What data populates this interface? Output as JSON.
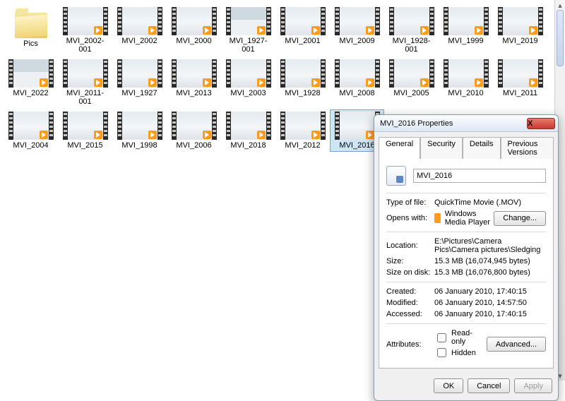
{
  "explorer": {
    "folder_label": "Pics",
    "items": [
      {
        "label": "MVI_2002-001",
        "scene": "snow"
      },
      {
        "label": "MVI_2002",
        "scene": "snow"
      },
      {
        "label": "MVI_2000",
        "scene": "snow"
      },
      {
        "label": "MVI_1927-001",
        "scene": "sky"
      },
      {
        "label": "MVI_2001",
        "scene": "snow"
      },
      {
        "label": "MVI_2009",
        "scene": "snow"
      },
      {
        "label": "MVI_1928-001",
        "scene": "snow"
      },
      {
        "label": "MVI_1999",
        "scene": "snow"
      },
      {
        "label": "MVI_2019",
        "scene": "snow"
      },
      {
        "label": "MVI_2022",
        "scene": "sky"
      },
      {
        "label": "MVI_2011-001",
        "scene": "snow"
      },
      {
        "label": "MVI_1927",
        "scene": "snow"
      },
      {
        "label": "MVI_2013",
        "scene": "snow"
      },
      {
        "label": "MVI_2003",
        "scene": "snow"
      },
      {
        "label": "MVI_1928",
        "scene": "snow"
      },
      {
        "label": "MVI_2008",
        "scene": "snow"
      },
      {
        "label": "MVI_2005",
        "scene": "snow"
      },
      {
        "label": "MVI_2010",
        "scene": "snow"
      },
      {
        "label": "MVI_2011",
        "scene": "snow"
      },
      {
        "label": "MVI_2004",
        "scene": "snow"
      },
      {
        "label": "MVI_2015",
        "scene": "snow"
      },
      {
        "label": "MVI_1998",
        "scene": "snow"
      },
      {
        "label": "MVI_2006",
        "scene": "snow"
      },
      {
        "label": "MVI_2018",
        "scene": "snow"
      },
      {
        "label": "MVI_2012",
        "scene": "snow"
      },
      {
        "label": "MVI_2016",
        "scene": "snow",
        "selected": true
      }
    ]
  },
  "dialog": {
    "title": "MVI_2016 Properties",
    "close": "X",
    "tabs": {
      "general": "General",
      "security": "Security",
      "details": "Details",
      "prev": "Previous Versions"
    },
    "filename": "MVI_2016",
    "labels": {
      "type": "Type of file:",
      "opens": "Opens with:",
      "location": "Location:",
      "size": "Size:",
      "disk": "Size on disk:",
      "created": "Created:",
      "modified": "Modified:",
      "accessed": "Accessed:",
      "attributes": "Attributes:"
    },
    "values": {
      "type": "QuickTime Movie (.MOV)",
      "opens": "Windows Media Player",
      "location": "E:\\Pictures\\Camera Pics\\Camera pictures\\Sledging",
      "size": "15.3 MB (16,074,945 bytes)",
      "disk": "15.3 MB (16,076,800 bytes)",
      "created": "06 January 2010, 17:40:15",
      "modified": "06 January 2010, 14:57:50",
      "accessed": "06 January 2010, 17:40:15"
    },
    "buttons": {
      "change": "Change...",
      "advanced": "Advanced...",
      "ok": "OK",
      "cancel": "Cancel",
      "apply": "Apply"
    },
    "attrs": {
      "readonly": "Read-only",
      "hidden": "Hidden"
    }
  }
}
